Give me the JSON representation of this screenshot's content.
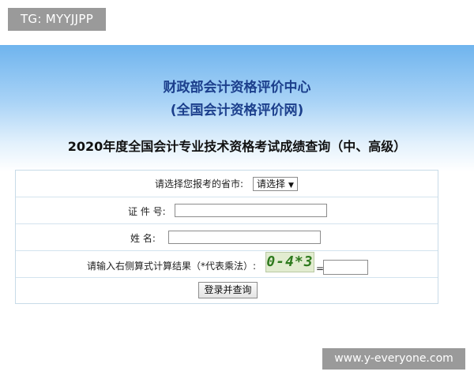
{
  "watermarks": {
    "top_tag": "TG: MYYJJPP",
    "bottom_tag": "www.y-everyone.com"
  },
  "header": {
    "org_name": "财政部会计资格评价中心",
    "site_name": "(全国会计资格评价网)",
    "page_title": "2020年度全国会计专业技术资格考试成绩查询（中、高级）"
  },
  "form": {
    "province_label": "请选择您报考的省市:",
    "province_selected": "请选择",
    "id_label": "证 件 号:",
    "id_value": "",
    "name_label": "姓  名:",
    "name_value": "",
    "captcha_label": "请输入右侧算式计算结果（*代表乘法）:",
    "captcha_text": "0-4*3",
    "equals_sign": "=",
    "captcha_answer": "",
    "submit_label": "登录并查询"
  },
  "colors": {
    "header_blue": "#6fb4ee",
    "title_blue": "#1c3f8c",
    "captcha_green": "#2f7a1e"
  }
}
